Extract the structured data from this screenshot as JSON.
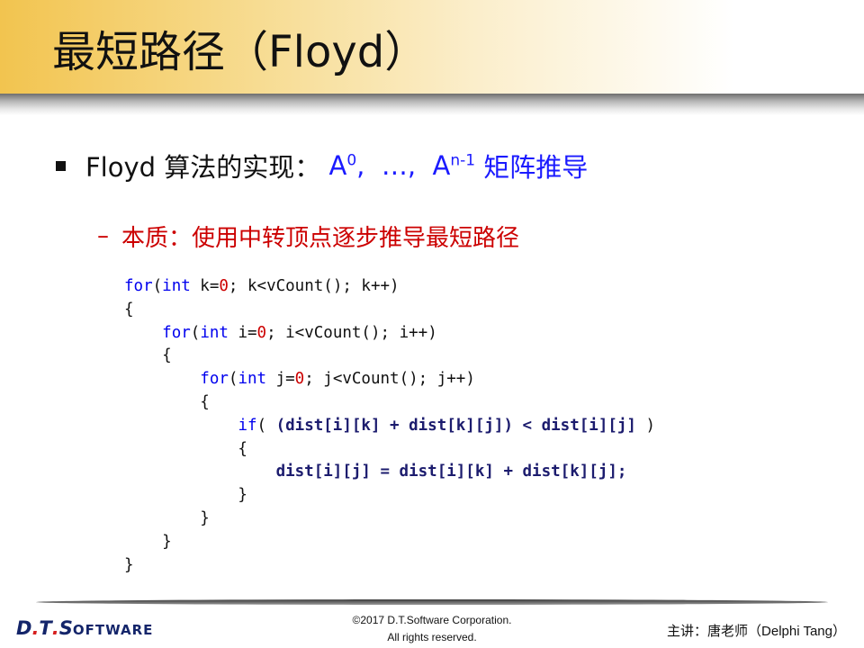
{
  "title": "最短路径（Floyd）",
  "bullet": {
    "lead": "Floyd 算法的实现：",
    "a0_base": "A",
    "a0_sup": "0",
    "mid": ",  …,  ",
    "an_base": "A",
    "an_sup": "n-1",
    "tail": " 矩阵推导"
  },
  "sub_bullet": {
    "dash": "–",
    "text": "本质：使用中转顶点逐步推导最短路径"
  },
  "code_lines": {
    "l1": {
      "kw": "for",
      "a": "(",
      "kw2": "int",
      "b": " k=",
      "num": "0",
      "c": "; k<vCount(); k++)"
    },
    "l2": "{",
    "l3": {
      "indent": "    ",
      "kw": "for",
      "a": "(",
      "kw2": "int",
      "b": " i=",
      "num": "0",
      "c": "; i<vCount(); i++)"
    },
    "l4": "    {",
    "l5": {
      "indent": "        ",
      "kw": "for",
      "a": "(",
      "kw2": "int",
      "b": " j=",
      "num": "0",
      "c": "; j<vCount(); j++)"
    },
    "l6": "        {",
    "l7": {
      "indent": "            ",
      "kw": "if",
      "a": "( ",
      "bold": "(dist[i][k] + dist[k][j]) < dist[i][j]",
      "c": " )"
    },
    "l8": "            {",
    "l9": {
      "indent": "                ",
      "bold": "dist[i][j] = dist[i][k] + dist[k][j];"
    },
    "l10": "            }",
    "l11": "        }",
    "l12": "    }",
    "l13": "}"
  },
  "footer": {
    "logo_d": "D",
    "logo_dot1": ".",
    "logo_t": "T",
    "logo_dot2": ".",
    "logo_s": "S",
    "logo_rest": "OFTWARE",
    "copyright_1": "©2017 D.T.Software Corporation.",
    "copyright_2": "All rights reserved.",
    "lecturer": "主讲：唐老师（Delphi Tang）"
  },
  "colors": {
    "title_gold": "#f2c44f",
    "blue": "#1a1aff",
    "red": "#cc0000",
    "keyword": "#0000ee",
    "logo_navy": "#14256a"
  }
}
